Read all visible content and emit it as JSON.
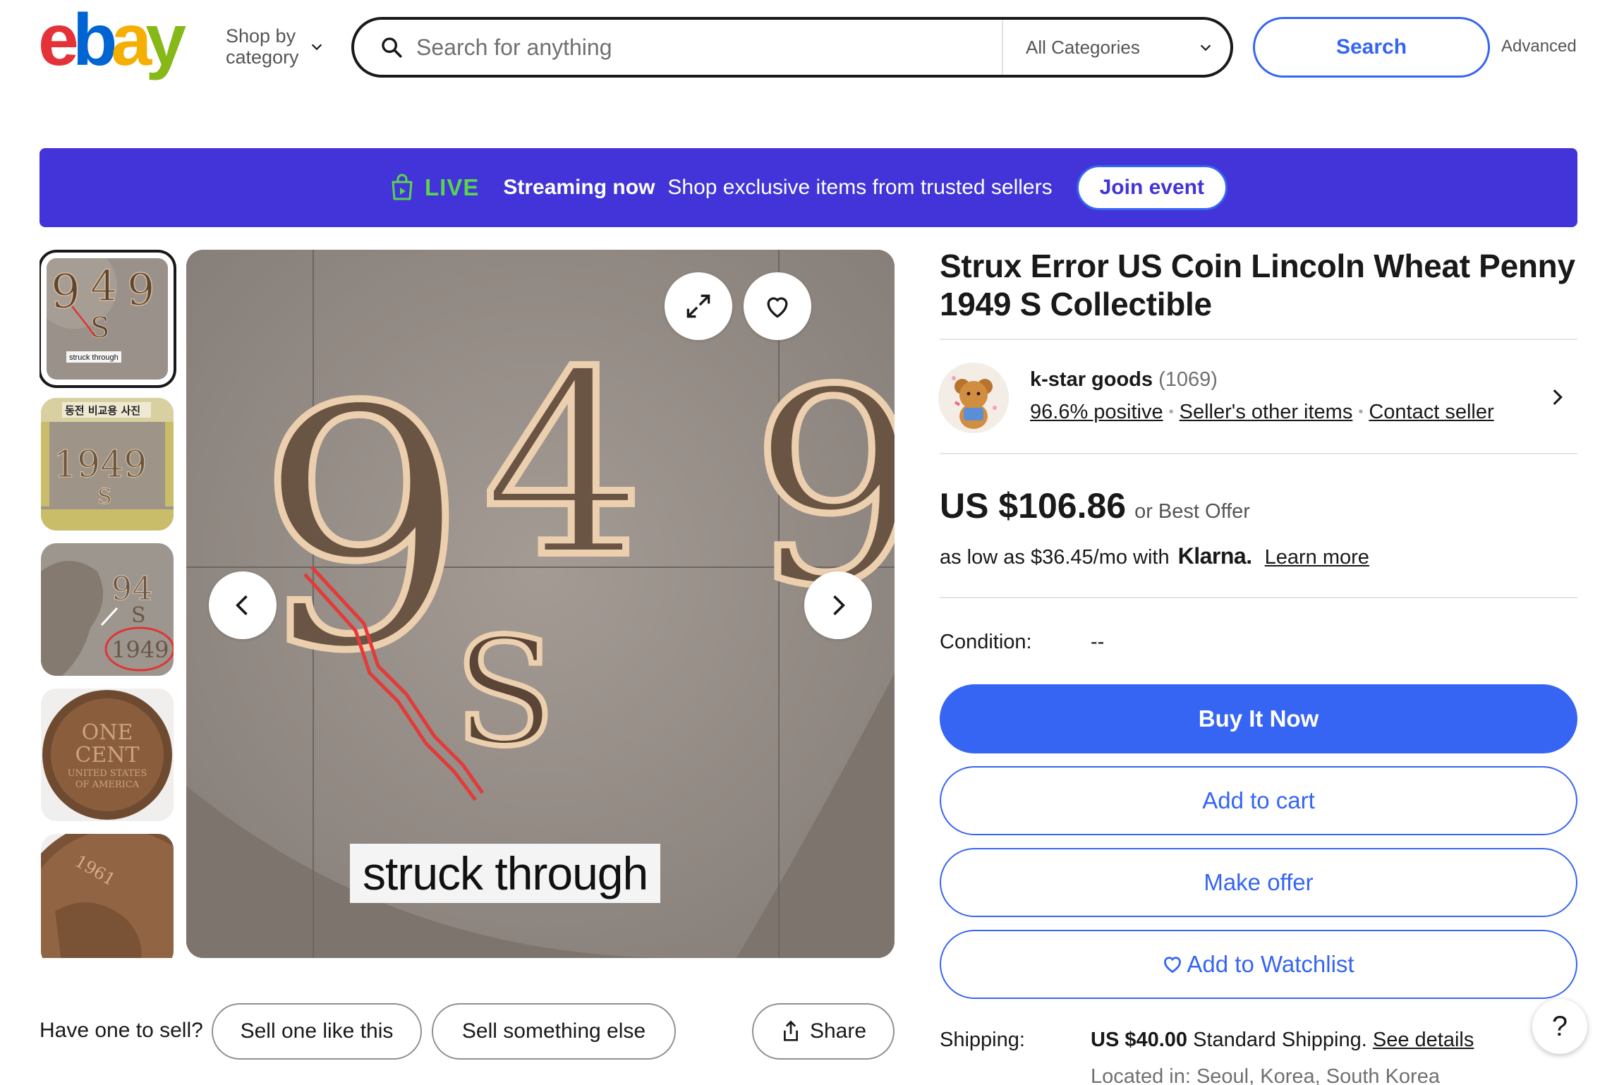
{
  "header": {
    "logo_text": "ebay",
    "shop_by_category": [
      "Shop by",
      "category"
    ],
    "search_placeholder": "Search for anything",
    "category_selected": "All Categories",
    "search_button": "Search",
    "advanced_link": "Advanced"
  },
  "banner": {
    "live_label": "LIVE",
    "streaming_label": "Streaming now",
    "message": "Shop exclusive items from trusted sellers",
    "join_button": "Join event",
    "background_color": "#4234d8",
    "live_color": "#59d44c"
  },
  "gallery": {
    "thumbnails": [
      {
        "name": "thumb-struck-through",
        "label": "struck through",
        "selected": true
      },
      {
        "name": "thumb-comparison-photo",
        "label": "동전 비교용 사진",
        "selected": false
      },
      {
        "name": "thumb-lincoln-profile",
        "selected": false
      },
      {
        "name": "thumb-one-cent-reverse",
        "lines": [
          "ONE",
          "CENT",
          "UNITED STATES",
          "OF AMERICA"
        ],
        "selected": false
      },
      {
        "name": "thumb-coin-obverse",
        "selected": false
      }
    ],
    "main_image": {
      "caption": "struck through",
      "visible_glyphs": [
        "9",
        "4",
        "9",
        "S"
      ]
    },
    "icons": [
      "expand-icon",
      "heart-icon",
      "chevron-left-icon",
      "chevron-right-icon"
    ]
  },
  "sell_row": {
    "label": "Have one to sell?",
    "sell_like_button": "Sell one like this",
    "sell_else_button": "Sell something else",
    "share_button": "Share"
  },
  "listing": {
    "title": "Strux Error US Coin Lincoln Wheat Penny 1949 S Collectible",
    "seller": {
      "name": "k-star goods",
      "feedback_count": "(1069)",
      "positive": "96.6% positive",
      "other_items": "Seller's other items",
      "contact": "Contact seller"
    },
    "price": "US $106.86",
    "best_offer": "or Best Offer",
    "klarna": {
      "text": "as low as $36.45/mo with",
      "brand": "Klarna.",
      "learn_more": "Learn more"
    },
    "condition_label": "Condition:",
    "condition_value": "--",
    "buttons": {
      "buy_now": "Buy It Now",
      "add_to_cart": "Add to cart",
      "make_offer": "Make offer",
      "watchlist": "Add to Watchlist"
    },
    "shipping_label": "Shipping:",
    "shipping_price": "US $40.00",
    "shipping_method": "Standard Shipping.",
    "shipping_details": "See details",
    "located": "Located in: Seoul, Korea, South Korea",
    "accent_color": "#3665f3"
  },
  "help_button": "?"
}
